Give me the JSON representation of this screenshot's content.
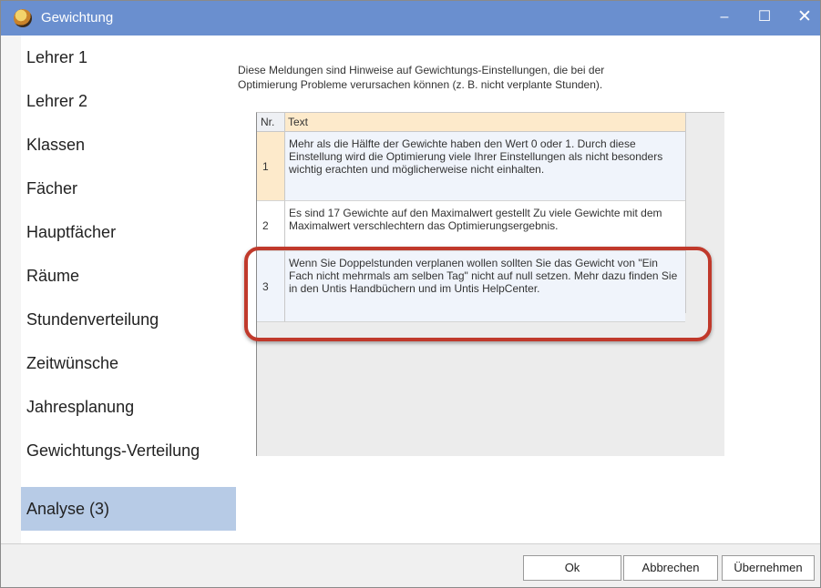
{
  "window": {
    "title": "Gewichtung"
  },
  "titlebar_buttons": {
    "minimize": "–",
    "maximize": "☐",
    "close": "✕"
  },
  "sidebar": {
    "items": [
      {
        "label": "Lehrer 1"
      },
      {
        "label": "Lehrer 2"
      },
      {
        "label": "Klassen"
      },
      {
        "label": "Fächer"
      },
      {
        "label": "Hauptfächer"
      },
      {
        "label": "Räume"
      },
      {
        "label": "Stundenverteilung"
      },
      {
        "label": "Zeitwünsche"
      },
      {
        "label": "Jahresplanung"
      },
      {
        "label": "Gewichtungs-Verteilung"
      },
      {
        "label": "Analyse (3)"
      }
    ],
    "active_index": 10
  },
  "content": {
    "hint_line1": "Diese Meldungen sind Hinweise auf Gewichtungs-Einstellungen, die bei der",
    "hint_line2": "Optimierung Probleme verursachen können (z. B. nicht verplante Stunden).",
    "table": {
      "headers": {
        "nr": "Nr.",
        "text": "Text"
      },
      "rows": [
        {
          "nr": "1",
          "text": "Mehr als die Hälfte der Gewichte haben den Wert 0 oder 1. Durch diese Einstellung wird die Optimierung viele Ihrer Einstellungen als nicht besonders wichtig erachten und möglicherweise nicht einhalten."
        },
        {
          "nr": "2",
          "text": "Es sind 17 Gewichte auf den Maximalwert gestellt Zu viele Gewichte mit dem Maximalwert verschlechtern das Optimierungsergebnis."
        },
        {
          "nr": "3",
          "text": "Wenn Sie Doppelstunden verplanen wollen sollten Sie das Gewicht von \"Ein Fach nicht mehrmals am selben Tag\" nicht auf null setzen. Mehr dazu finden Sie in den Untis Handbüchern und im Untis HelpCenter."
        }
      ]
    },
    "highlight_color": "#c0392b"
  },
  "footer": {
    "ok": "Ok",
    "cancel": "Abbrechen",
    "apply": "Übernehmen"
  },
  "colors": {
    "titlebar": "#6a8fcf",
    "active_nav": "#b7cbe6",
    "header_accent": "#fdeacb"
  }
}
